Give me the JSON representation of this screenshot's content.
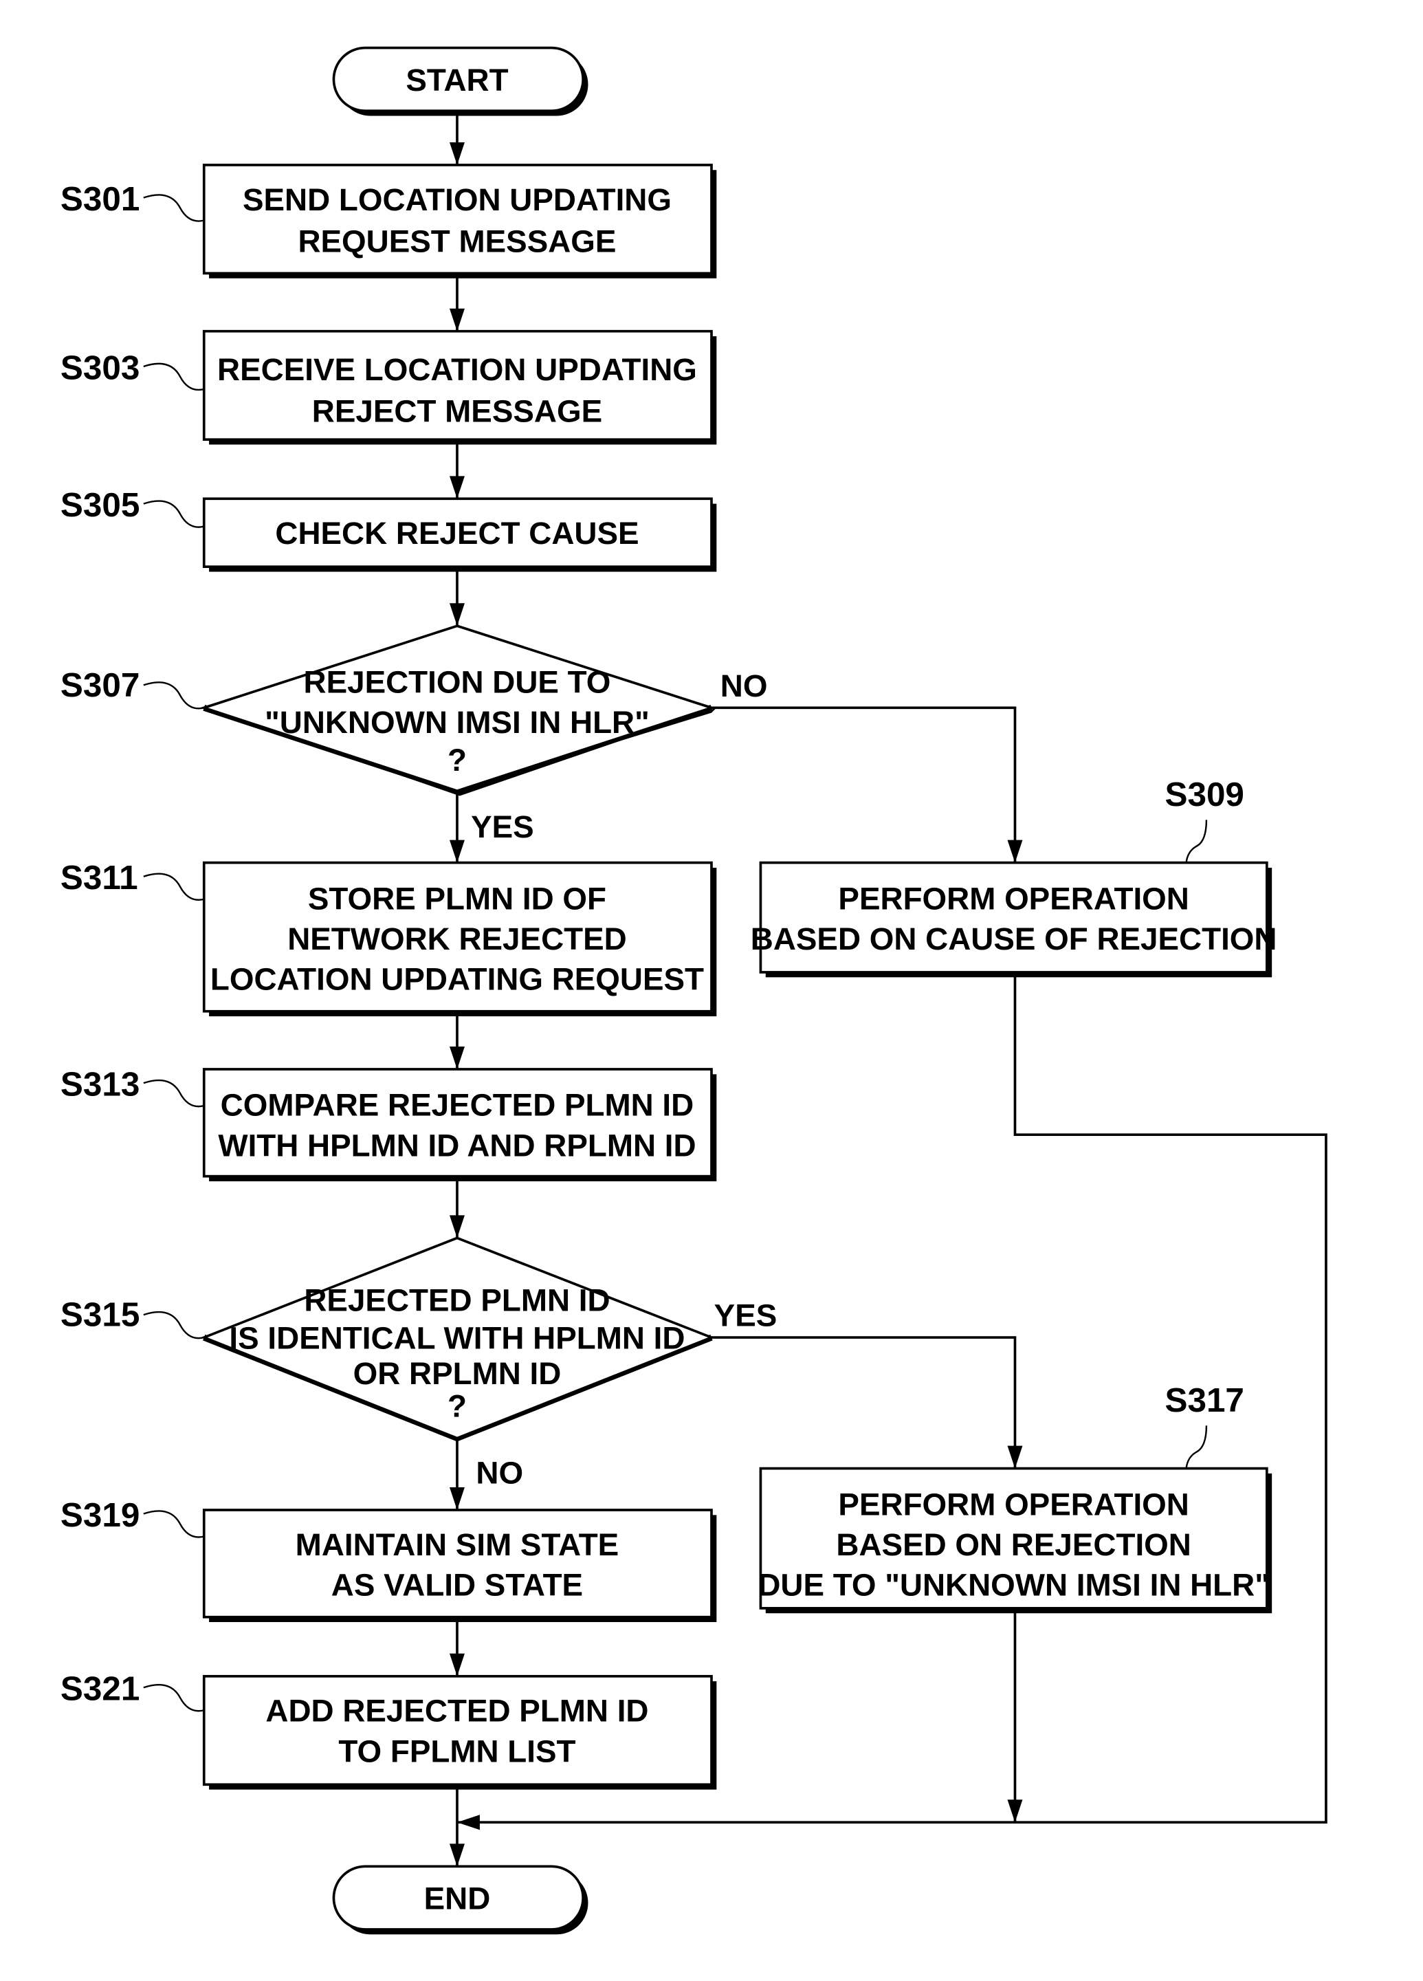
{
  "diagram": {
    "type": "flowchart",
    "terminals": {
      "start": "START",
      "end": "END"
    },
    "steps": {
      "s301": {
        "id": "S301",
        "lines": [
          "SEND LOCATION UPDATING",
          "REQUEST MESSAGE"
        ]
      },
      "s303": {
        "id": "S303",
        "lines": [
          "RECEIVE LOCATION UPDATING",
          "REJECT MESSAGE"
        ]
      },
      "s305": {
        "id": "S305",
        "lines": [
          "CHECK REJECT CAUSE"
        ]
      },
      "s307": {
        "id": "S307",
        "lines": [
          "REJECTION DUE TO",
          "\"UNKNOWN IMSI IN HLR\"",
          "?"
        ]
      },
      "s309": {
        "id": "S309",
        "lines": [
          "PERFORM OPERATION",
          "BASED ON CAUSE OF REJECTION"
        ]
      },
      "s311": {
        "id": "S311",
        "lines": [
          "STORE PLMN ID OF",
          "NETWORK REJECTED",
          "LOCATION UPDATING REQUEST"
        ]
      },
      "s313": {
        "id": "S313",
        "lines": [
          "COMPARE REJECTED PLMN ID",
          "WITH HPLMN ID AND RPLMN ID"
        ]
      },
      "s315": {
        "id": "S315",
        "lines": [
          "REJECTED PLMN ID",
          "IS IDENTICAL WITH HPLMN ID",
          "OR RPLMN ID",
          "?"
        ]
      },
      "s317": {
        "id": "S317",
        "lines": [
          "PERFORM OPERATION",
          "BASED ON REJECTION",
          "DUE TO \"UNKNOWN IMSI IN HLR\""
        ]
      },
      "s319": {
        "id": "S319",
        "lines": [
          "MAINTAIN SIM STATE",
          "AS VALID STATE"
        ]
      },
      "s321": {
        "id": "S321",
        "lines": [
          "ADD REJECTED PLMN ID",
          "TO FPLMN LIST"
        ]
      }
    },
    "branches": {
      "s307_yes": "YES",
      "s307_no": "NO",
      "s315_yes": "YES",
      "s315_no": "NO"
    },
    "edges": [
      {
        "from": "START",
        "to": "S301"
      },
      {
        "from": "S301",
        "to": "S303"
      },
      {
        "from": "S303",
        "to": "S305"
      },
      {
        "from": "S305",
        "to": "S307"
      },
      {
        "from": "S307",
        "to": "S311",
        "label": "YES"
      },
      {
        "from": "S307",
        "to": "S309",
        "label": "NO"
      },
      {
        "from": "S311",
        "to": "S313"
      },
      {
        "from": "S313",
        "to": "S315"
      },
      {
        "from": "S315",
        "to": "S319",
        "label": "NO"
      },
      {
        "from": "S315",
        "to": "S317",
        "label": "YES"
      },
      {
        "from": "S319",
        "to": "S321"
      },
      {
        "from": "S321",
        "to": "END"
      },
      {
        "from": "S309",
        "to": "END"
      },
      {
        "from": "S317",
        "to": "END"
      }
    ]
  }
}
